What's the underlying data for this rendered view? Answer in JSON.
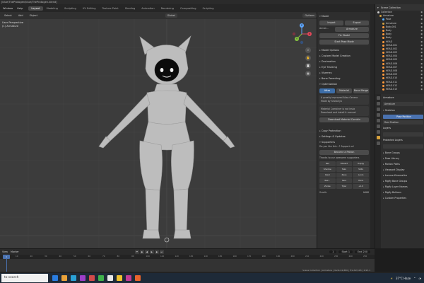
{
  "window": {
    "title": "[blue/TheProtogen/blue/TheProtogen.blend]"
  },
  "menubar": {
    "items": [
      "Window",
      "Help"
    ],
    "workspaces": [
      "Layout",
      "Modeling",
      "Sculpting",
      "UV Editing",
      "Texture Paint",
      "Shading",
      "Animation",
      "Rendering",
      "Compositing",
      "Scripting"
    ],
    "active_workspace": 0,
    "scene": "Scene",
    "view_layer": "ViewLayer"
  },
  "viewport_header": {
    "buttons": [
      "Select",
      "Add",
      "Object"
    ],
    "transform": "Global",
    "options": "Options"
  },
  "viewport": {
    "info_line1": "User Perspective",
    "info_line2": "(1) Armature"
  },
  "gizmo": {
    "x": "X",
    "y": "Y",
    "z": "Z"
  },
  "npanel": {
    "model_section": "Model",
    "import_label": "Import",
    "export_label": "Export",
    "armature_label": "Armat...",
    "armature_value": "Armature",
    "fix_model": "Fix Model",
    "start_pose_mode": "Start Pose Mode",
    "sections": [
      "Model Options",
      "Custom Model Creation",
      "Decimation",
      "Eye Tracking",
      "Visemes",
      "Bone Parenting",
      "Optimization"
    ],
    "optimization_tabs": [
      "Atlas",
      "Material",
      "Bone Merge"
    ],
    "atlas_text1": "A greatly improved Atlas Genera",
    "atlas_text2": "Made by Shotariya",
    "atlas_text3": "Material Combiner is not insta",
    "atlas_text4": "Download and install it manual",
    "download_btn": "Download Material Combin",
    "lower_sections": [
      "Copy Protection",
      "Settings & Updates",
      "Supporters"
    ],
    "supporter_text": "Do you like this...? Support us!",
    "become_patron": "Become a Patron",
    "thanks": "Thanks to our awesome supporters",
    "supporters": [
      "Rez",
      "Edward",
      "Happy",
      "Shadow",
      "Tako",
      "Shito",
      "Owel",
      "Zeus",
      "Lovin",
      "Rez...",
      "Sara",
      "Hans",
      "Zonke",
      "Tyler",
      "+1.0"
    ],
    "footer_left": "Scrolls",
    "footer_right": "A666"
  },
  "outliner": {
    "header": "Scene Collection",
    "rows": [
      {
        "name": "Collection",
        "color": "#cccccc"
      },
      {
        "name": "Armature",
        "color": "#d0a040"
      },
      {
        "name": "Pose",
        "color": "#5ab0ff"
      },
      {
        "name": "Armature",
        "color": "#d0a040"
      },
      {
        "name": "Body.001",
        "color": "#ff9a3c"
      },
      {
        "name": "Body",
        "color": "#ff9a3c"
      },
      {
        "name": "Body",
        "color": "#ff9a3c"
      },
      {
        "name": "Body",
        "color": "#ff9a3c"
      },
      {
        "name": "HEAD",
        "color": "#ff9a3c"
      },
      {
        "name": "HEAD.001",
        "color": "#ff9a3c"
      },
      {
        "name": "HEAD.002",
        "color": "#ff9a3c"
      },
      {
        "name": "HEAD.003",
        "color": "#ff9a3c"
      },
      {
        "name": "HEAD.004",
        "color": "#ff9a3c"
      },
      {
        "name": "HEAD.005",
        "color": "#ff9a3c"
      },
      {
        "name": "HEAD.006",
        "color": "#ff9a3c"
      },
      {
        "name": "HEAD.007",
        "color": "#ff9a3c"
      },
      {
        "name": "HEAD.008",
        "color": "#ff9a3c"
      },
      {
        "name": "HEAD.009",
        "color": "#ff9a3c"
      },
      {
        "name": "HEAD.010",
        "color": "#ff9a3c"
      },
      {
        "name": "HEAD.011",
        "color": "#ff9a3c"
      },
      {
        "name": "HEAD.012",
        "color": "#ff9a3c"
      },
      {
        "name": "HEAD.013",
        "color": "#ff9a3c"
      }
    ]
  },
  "properties": {
    "breadcrumb": "Armature",
    "data_name": "Armature",
    "skeleton_section": "Skeleton",
    "pose_position": "Pose Position",
    "rest_position": "Rest Position",
    "layers_label": "Layers",
    "protected_layers": "Protected Layers",
    "sections": [
      "Bone Groups",
      "Pose Library",
      "Motion Paths",
      "Viewport Display",
      "Inverse Kinematics",
      "Rigify Bone Groups",
      "Rigify Layer Names",
      "Rigify Buttons",
      "Custom Properties"
    ]
  },
  "timeline": {
    "menus": [
      "View",
      "Marker"
    ],
    "start": "Start 1",
    "end": "End 250",
    "current": "1",
    "ticks": [
      "10",
      "20",
      "30",
      "40",
      "50",
      "60",
      "70",
      "80",
      "90",
      "100",
      "110",
      "120",
      "130",
      "140",
      "150",
      "160",
      "170",
      "180",
      "190",
      "200",
      "210",
      "220",
      "230",
      "240",
      "250"
    ]
  },
  "status": {
    "text": "Scene Collection | Armature | Verts:41,880 | Tris:82,518 | 2.93.1"
  },
  "taskbar": {
    "search_placeholder": "to search",
    "weather": "37°C Haze",
    "icon_colors": [
      "#2a7de1",
      "#e8a13a",
      "#2aa1d6",
      "#9e3ec9",
      "#d24a4a",
      "#3fb24b",
      "#e9e9e9",
      "#f0c22e",
      "#c23b96",
      "#e8642c"
    ]
  },
  "colors": {
    "accent_blue": "#4a72b0",
    "viewport_bg": "#3c3c3c",
    "model_color": "#bdbdbd"
  }
}
